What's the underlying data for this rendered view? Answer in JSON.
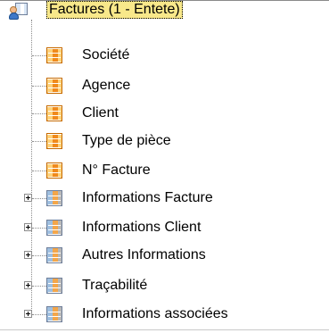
{
  "tree": {
    "root": {
      "label": "Factures (1 - Entete)",
      "icon": "user-grid-icon"
    },
    "children": [
      {
        "label": "Société",
        "icon": "field-icon",
        "expandable": false
      },
      {
        "label": "Agence",
        "icon": "field-icon",
        "expandable": false
      },
      {
        "label": "Client",
        "icon": "field-icon",
        "expandable": false
      },
      {
        "label": "Type de pièce",
        "icon": "field-icon",
        "expandable": false
      },
      {
        "label": "N° Facture",
        "icon": "field-icon",
        "expandable": false
      },
      {
        "label": "Informations Facture",
        "icon": "group-icon",
        "expandable": true
      },
      {
        "label": "Informations Client",
        "icon": "group-icon",
        "expandable": true
      },
      {
        "label": "Autres Informations",
        "icon": "group-icon",
        "expandable": true
      },
      {
        "label": "Traçabilité",
        "icon": "group-icon",
        "expandable": true
      },
      {
        "label": "Informations associées",
        "icon": "group-icon",
        "expandable": true
      }
    ]
  },
  "colors": {
    "selection_background": "#f8e88a",
    "tree_line": "#8c8c8c"
  }
}
